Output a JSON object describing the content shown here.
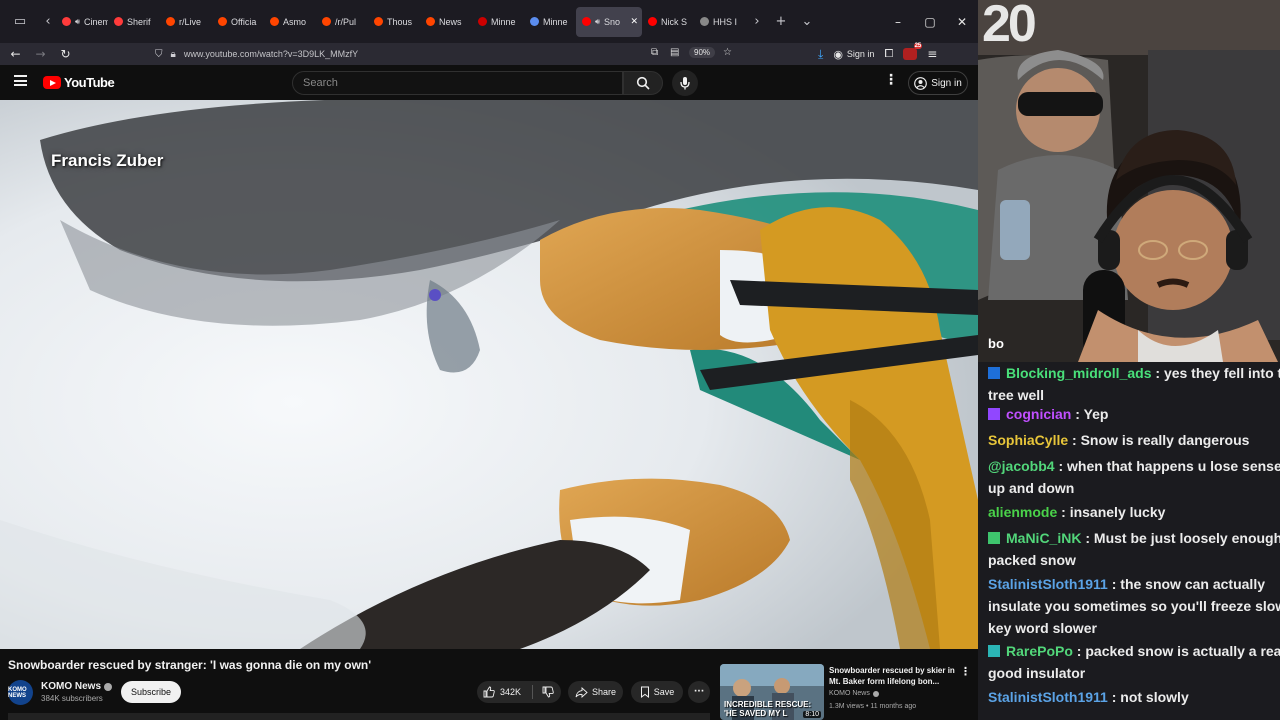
{
  "browser": {
    "tabs": [
      {
        "label": "Cinem",
        "fav_color": "#ff3b3b",
        "audio": true
      },
      {
        "label": "Sherif",
        "fav_color": "#ff3b3b"
      },
      {
        "label": "r/Live",
        "fav_color": "#ff4500"
      },
      {
        "label": "Officia",
        "fav_color": "#ff4500"
      },
      {
        "label": "Asmo",
        "fav_color": "#ff4500"
      },
      {
        "label": "/r/Pul",
        "fav_color": "#ff4500"
      },
      {
        "label": "Thous",
        "fav_color": "#ff4500"
      },
      {
        "label": "News",
        "fav_color": "#ff4500"
      },
      {
        "label": "Minne",
        "fav_color": "#cc0000"
      },
      {
        "label": "Minne",
        "fav_color": "#5b8def"
      },
      {
        "label": "Sno",
        "fav_color": "#ff0000",
        "audio": true,
        "active": true
      },
      {
        "label": "Nick S",
        "fav_color": "#ff0000"
      },
      {
        "label": "HHS I",
        "fav_color": "#888888"
      }
    ],
    "url": "www.youtube.com/watch?v=3D9LK_MMzfY",
    "zoom": "90%",
    "sign_in": "Sign in",
    "ext_badge": "25"
  },
  "youtube": {
    "logo_text": "YouTube",
    "search_placeholder": "Search",
    "sign_in": "Sign in"
  },
  "video": {
    "overlay_name": "Francis Zuber",
    "title": "Snowboarder rescued by stranger: 'I was gonna die on my own'",
    "channel": "KOMO News",
    "channel_avatar_text": "KOMO NEWS",
    "subscribers": "384K subscribers",
    "subscribe": "Subscribe",
    "likes": "342K",
    "share": "Share",
    "save": "Save"
  },
  "recommended": {
    "thumb_text": "INCREDIBLE RESCUE: 'HE SAVED MY L",
    "duration": "8:10",
    "title": "Snowboarder rescued by skier in Mt. Baker form lifelong bon...",
    "channel": "KOMO News",
    "meta": "1.3M views • 11 months ago"
  },
  "webcam": {
    "overlay_text": "20",
    "corner_text": "bo"
  },
  "chat": [
    {
      "user": "Blocking_midroll_ads",
      "color": "#49e07a",
      "badge": "#1e6fd9",
      "text": "yes they fell into the",
      "text2": "tree well"
    },
    {
      "user": "cognician",
      "color": "#c04fff",
      "badge": "#9147ff",
      "text": "Yep"
    },
    {
      "user": "SophiaCylle",
      "color": "#e8c63a",
      "badge": "",
      "text": "Snow is really dangerous"
    },
    {
      "user": "@jacobb4",
      "color": "#52d67a",
      "badge": "",
      "text": "when that happens u lose sense o",
      "text2": "up and down"
    },
    {
      "user": "alienmode",
      "color": "#4ad24a",
      "badge": "",
      "text": "insanely lucky"
    },
    {
      "user": "MaNiC_iNK",
      "color": "#52d67a",
      "badge": "#3ec46d",
      "text": "Must be just loosely enough",
      "text2": "packed snow"
    },
    {
      "user": "StalinistSloth1911",
      "color": "#5ba3e6",
      "badge": "",
      "text": "the snow can actually",
      "text2": "insulate you sometimes so you'll freeze slowe",
      "text3": "key word slower"
    },
    {
      "user": "RarePoPo",
      "color": "#52d67a",
      "badge": "#2bb5b5",
      "text": "packed snow is actually a really",
      "text2": "good insulator"
    },
    {
      "user": "StalinistSloth1911",
      "color": "#5ba3e6",
      "badge": "",
      "text": "not slowly"
    }
  ]
}
